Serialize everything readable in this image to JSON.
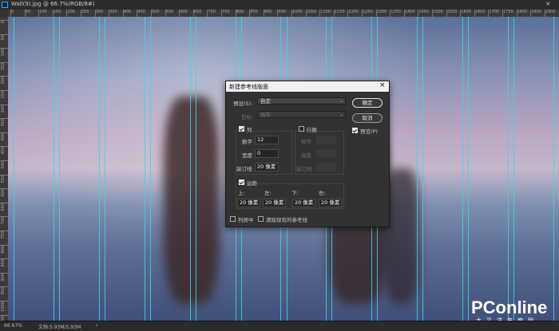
{
  "window": {
    "title": "Wall(9).jpg @ 66.7%(RGB/8#)",
    "close": "×"
  },
  "ruler": {
    "h_labels": [
      "0",
      "50",
      "100",
      "150",
      "200",
      "250",
      "300",
      "350",
      "400",
      "450",
      "500",
      "550",
      "600",
      "650",
      "700",
      "750",
      "800",
      "850",
      "900",
      "950",
      "1000",
      "1050",
      "1100",
      "1150",
      "1200",
      "1250",
      "1300",
      "1350",
      "1400",
      "1450",
      "1500",
      "1550",
      "1600",
      "1650",
      "1700",
      "1750",
      "1800",
      "1850",
      "1900"
    ],
    "v_labels": [
      "0",
      "50",
      "100",
      "150",
      "200",
      "250",
      "300",
      "350",
      "400",
      "450",
      "500",
      "550",
      "600",
      "650",
      "700",
      "750",
      "800",
      "850",
      "900",
      "950",
      "1000",
      "1050"
    ]
  },
  "status": {
    "zoom": "66.67%",
    "doc": "文档:5.93M/5.93M",
    "chevron": "›"
  },
  "watermark": {
    "brand": "PConline",
    "sub": "太平洋电脑网"
  },
  "dialog": {
    "title": "新建参考线版面",
    "close": "×",
    "preset_label": "预设(S):",
    "preset_value": "自定",
    "target_label": "目标:",
    "target_value": "画布",
    "ok": "确定",
    "cancel": "取消",
    "preview": {
      "label": "预览(P)",
      "checked": true
    },
    "columns": {
      "label": "列",
      "checked": true,
      "number_label": "数字",
      "number": "12",
      "width_label": "宽度",
      "width": "0",
      "gutter_label": "装订线",
      "gutter": "20 像素"
    },
    "rows": {
      "label": "行数",
      "checked": false,
      "number_label": "数字",
      "height_label": "高度",
      "gutter_label": "装订线"
    },
    "margin": {
      "label": "边距",
      "checked": true,
      "top_label": "上:",
      "left_label": "左:",
      "bottom_label": "下:",
      "right_label": "右:",
      "top": "20 像素",
      "left": "20 像素",
      "bottom": "20 像素",
      "right": "20 像素"
    },
    "center_columns": {
      "label": "列居中",
      "checked": false
    },
    "clear_guides": {
      "label": "清除现有的参考线",
      "checked": false
    }
  },
  "colors": {
    "guide": "#38d7e8",
    "dialog_bg": "#323232",
    "accent": "#31a8ff"
  }
}
